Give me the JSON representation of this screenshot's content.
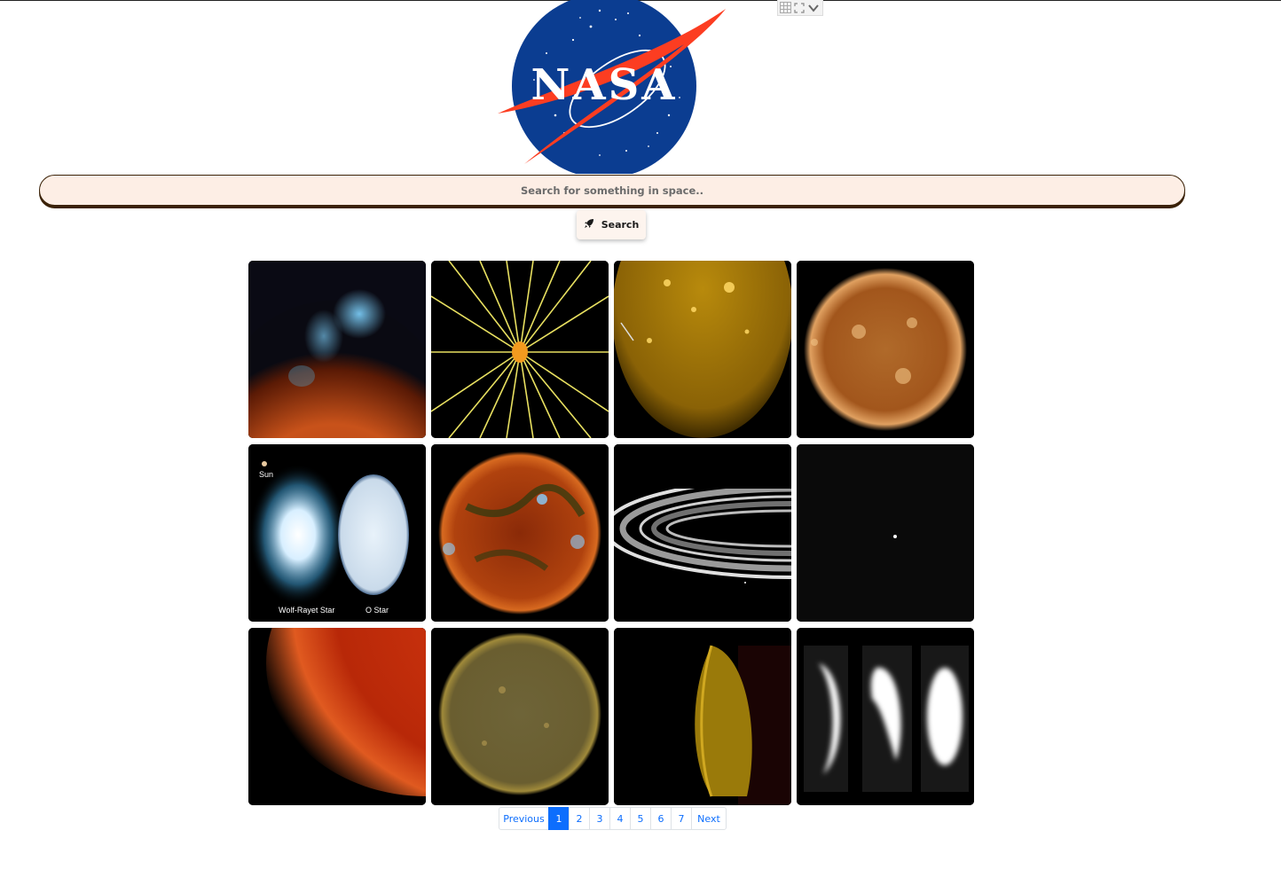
{
  "header": {
    "logo_text": "NASA"
  },
  "widget": {
    "icons": [
      "grid-icon",
      "expand-icon",
      "chevron-down-icon"
    ]
  },
  "search": {
    "placeholder": "Search for something in space..",
    "value": "",
    "button_label": "Search",
    "button_icon": "rocket-icon"
  },
  "gallery": {
    "images": [
      {
        "name": "sun-xray-nustar-image"
      },
      {
        "name": "sun-field-lines-diagram-image"
      },
      {
        "name": "sun-gold-closeup-image"
      },
      {
        "name": "sun-orange-full-disk-image"
      },
      {
        "name": "wolf-rayet-o-star-comparison-image",
        "labels": [
          "Sun",
          "Wolf-Rayet Star",
          "O Star"
        ]
      },
      {
        "name": "sun-multiwavelength-image"
      },
      {
        "name": "saturn-rings-image"
      },
      {
        "name": "dark-sky-point-image"
      },
      {
        "name": "sun-red-limb-image"
      },
      {
        "name": "sun-olive-disk-image"
      },
      {
        "name": "sun-crescent-gold-image"
      },
      {
        "name": "white-crescent-sequence-image"
      }
    ]
  },
  "pagination": {
    "previous_label": "Previous",
    "next_label": "Next",
    "pages": [
      "1",
      "2",
      "3",
      "4",
      "5",
      "6",
      "7"
    ],
    "active_page": "1"
  },
  "colors": {
    "search_bg": "#fdeee5",
    "search_border": "#3b2208",
    "accent": "#0d6efd",
    "nasa_blue": "#0b3d91",
    "nasa_red": "#fc3d21"
  }
}
